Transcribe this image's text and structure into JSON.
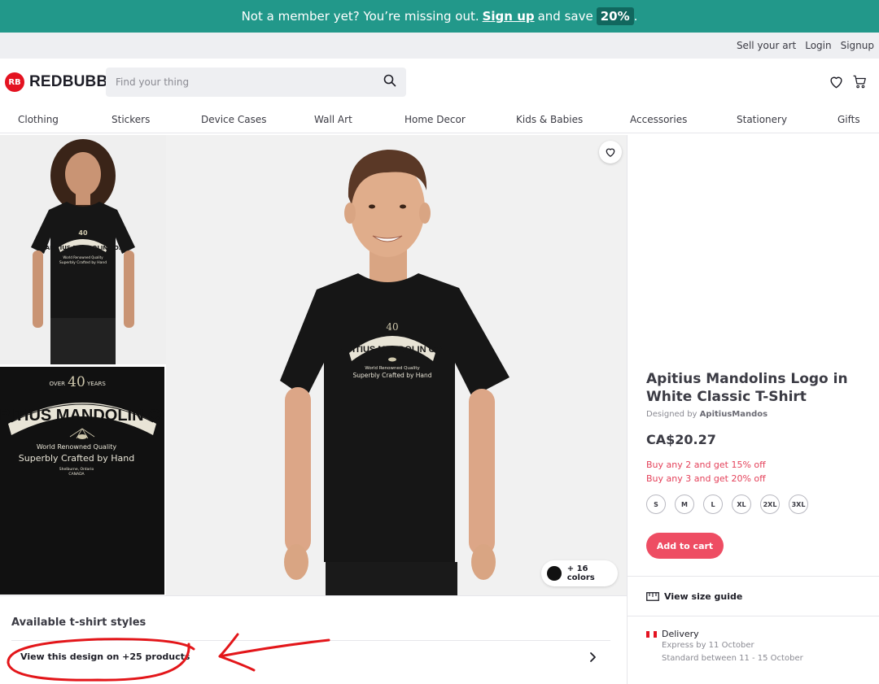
{
  "promo": {
    "text_before": "Not a member yet? You’re missing out.",
    "link": "Sign up",
    "text_after": "and save",
    "badge": "20%",
    "trail": "."
  },
  "util": {
    "sell": "Sell your art",
    "login": "Login",
    "signup": "Signup"
  },
  "header": {
    "logo_mark": "RB",
    "logo_text": "REDBUBBLE",
    "search_placeholder": "Find your thing",
    "icons": [
      "heart-icon",
      "cart-icon",
      "search-icon"
    ]
  },
  "nav": {
    "items": [
      "Clothing",
      "Stickers",
      "Device Cases",
      "Wall Art",
      "Home Decor",
      "Kids & Babies",
      "Accessories",
      "Stationery",
      "Gifts"
    ]
  },
  "design": {
    "over": "OVER",
    "num": "40",
    "years": "YEARS",
    "name": "APITIUS MANDOLIN CO.",
    "tag1": "World Renowned Quality",
    "tag2": "Superbly Crafted by Hand",
    "loc1": "Shelburne, Ontario",
    "loc2": "CANADA"
  },
  "gallery": {
    "colors_label": "+ 16 colors"
  },
  "product": {
    "title": "Apitius Mandolins Logo in White Classic T-Shirt",
    "designed_by_label": "Designed by",
    "designer": "ApitiusMandos",
    "price": "CA$20.27",
    "promo_1": "Buy any 2 and get 15% off",
    "promo_2": "Buy any 3 and get 20% off",
    "sizes": [
      "S",
      "M",
      "L",
      "XL",
      "2XL",
      "3XL"
    ],
    "add_to_cart": "Add to cart"
  },
  "size_guide": {
    "label": "View size guide"
  },
  "delivery": {
    "title": "Delivery",
    "express": "Express by 11 October",
    "standard": "Standard between 11 - 15 October"
  },
  "styles": {
    "title": "Available t-shirt styles",
    "view_products": "View this design on +25 products"
  },
  "colors": {
    "promo_bg": "#22988a",
    "badge_bg": "#11675e",
    "accent_red": "#ee4d63",
    "logo_red": "#e41321",
    "annotation_red": "#e3161a"
  }
}
